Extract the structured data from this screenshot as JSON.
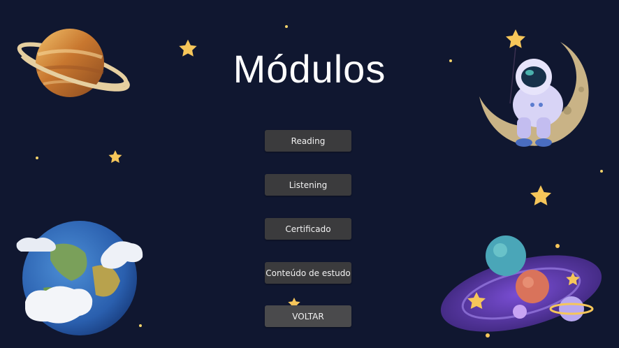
{
  "page": {
    "title": "Módulos"
  },
  "menu": {
    "buttons": [
      {
        "label": "Reading"
      },
      {
        "label": "Listening"
      },
      {
        "label": "Certificado"
      },
      {
        "label": "Conteúdo de estudo"
      }
    ],
    "back_label": "VOLTAR"
  },
  "theme": {
    "background": "#101730",
    "button_bg": "#3b3b3d",
    "button_text": "#f2f2f2",
    "star": "#f6c65a"
  },
  "decorations": [
    "saturn-icon",
    "astronaut-on-moon-icon",
    "earth-icon",
    "galaxy-planets-icon",
    "star-icon"
  ]
}
